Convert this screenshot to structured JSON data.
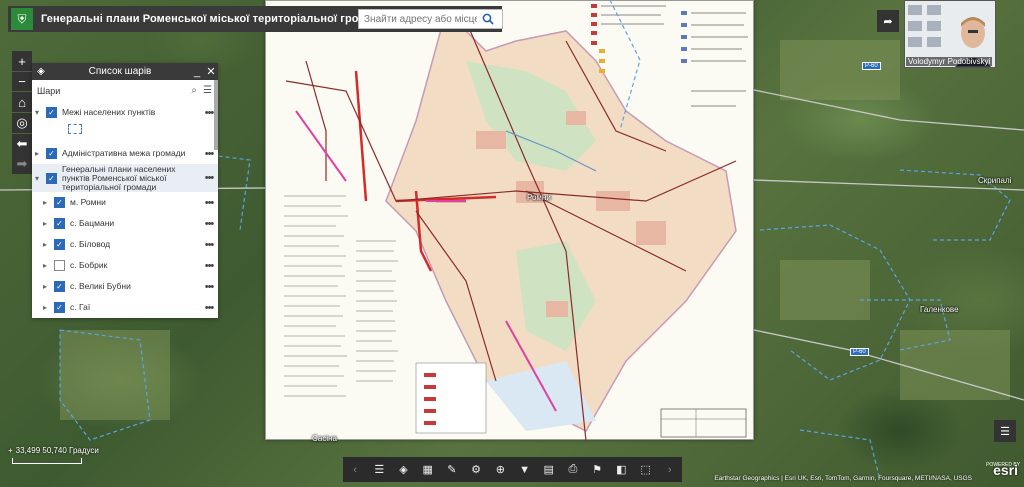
{
  "app": {
    "title": "Генеральні плани Роменської міської територіальної громади",
    "logo_icon": "coat-of-arms-icon"
  },
  "search": {
    "placeholder": "Знайти адресу або місце",
    "icon": "search-icon"
  },
  "map_tools": {
    "zoom_in": "+",
    "zoom_out": "−",
    "home_icon": "home-icon",
    "locate_icon": "locate-icon",
    "back_icon": "arrow-left-icon",
    "forward_icon": "arrow-right-icon"
  },
  "layer_panel": {
    "title": "Список шарів",
    "minimize": "_",
    "close": "✕",
    "subheader": "Шари",
    "layers": [
      {
        "label": "Межі населених пунктів",
        "checked": true,
        "expanded": true
      },
      {
        "label": "Адміністративна межа громади",
        "checked": true,
        "expanded": false
      },
      {
        "label": "Генеральні плани населених пунктів Роменської міської територіальної громади",
        "checked": true,
        "expanded": true
      },
      {
        "label": "м. Ромни",
        "checked": true,
        "expanded": false
      },
      {
        "label": "с. Бацмани",
        "checked": true,
        "expanded": false
      },
      {
        "label": "с. Біловод",
        "checked": true,
        "expanded": false
      },
      {
        "label": "с. Бобрик",
        "checked": false,
        "expanded": false
      },
      {
        "label": "с. Великі Бубни",
        "checked": true,
        "expanded": false
      },
      {
        "label": "с. Гаї",
        "checked": true,
        "expanded": false
      }
    ]
  },
  "video": {
    "participant_name": "Volodymyr Podobivskyi"
  },
  "map_labels": {
    "town_center": "Ромни",
    "village_east": "Скрипалі",
    "village_southeast": "Галенкове",
    "village_south": "Сасіна"
  },
  "status": {
    "coordinates": "33,499 50,740 Градуси",
    "attribution": "Earthstar Geographics | Esri UK, Esri, TomTom, Garmin, Foursquare, METI/NASA, USGS",
    "powered_by": "POWERED BY",
    "brand": "esri"
  },
  "toolbar": {
    "items": [
      {
        "name": "prev-icon"
      },
      {
        "name": "legend-icon"
      },
      {
        "name": "layers-icon"
      },
      {
        "name": "basemap-icon"
      },
      {
        "name": "draw-icon"
      },
      {
        "name": "analysis-icon"
      },
      {
        "name": "measure-icon"
      },
      {
        "name": "filter-icon"
      },
      {
        "name": "edit-icon"
      },
      {
        "name": "print-icon"
      },
      {
        "name": "bookmark-icon"
      },
      {
        "name": "swipe-icon"
      },
      {
        "name": "share-icon"
      },
      {
        "name": "next-icon"
      }
    ]
  },
  "colors": {
    "header_bg": "#3a3a3a",
    "accent_blue": "#2a6ab8",
    "plan_paper": "#fbfaf3",
    "road_red": "#d42a2a"
  }
}
